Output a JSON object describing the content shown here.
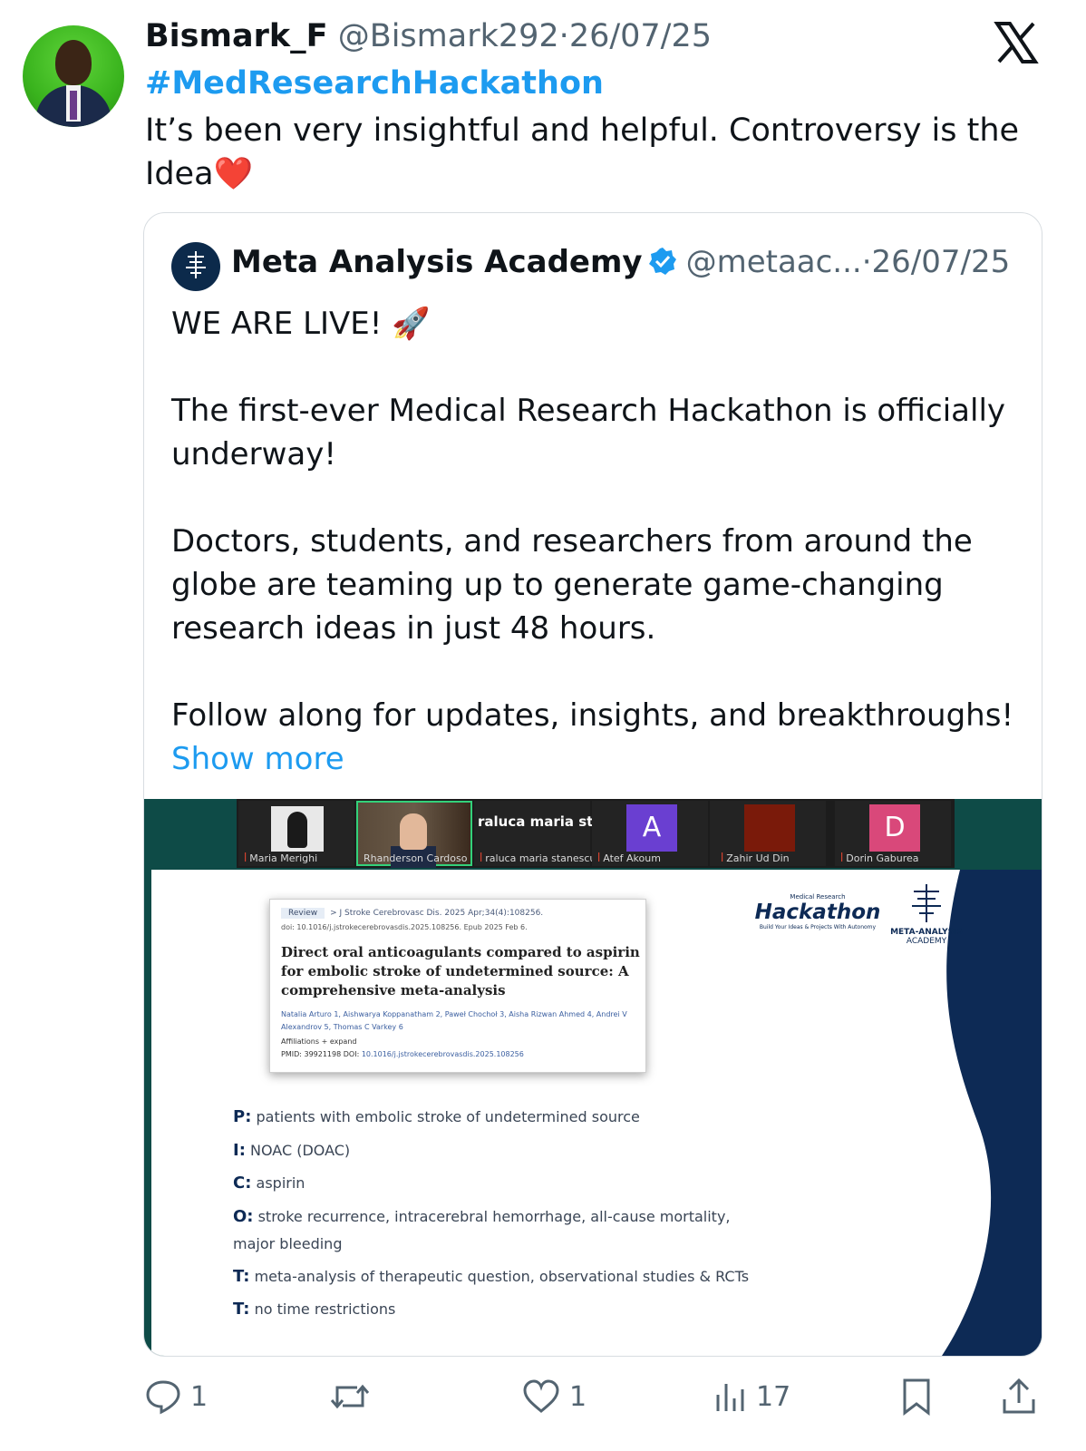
{
  "tweet": {
    "display_name": "Bismark_F",
    "handle": "@Bismark292",
    "sep": "·",
    "date": "26/07/25",
    "hashtag": "#MedResearchHackathon",
    "text": "It’s been very insightful and helpful. Controversy is the Idea",
    "emoji": "❤️"
  },
  "quote": {
    "display_name": "Meta Analysis Academy",
    "handle": "@metaac...",
    "sep": "·",
    "date": "26/07/25",
    "line1": "WE ARE LIVE! 🚀",
    "para1": "The first-ever Medical Research Hackathon is officially underway!",
    "para2": "Doctors, students, and researchers from around the globe are teaming up to generate game-changing research ideas in just 48 hours.",
    "para3": "Follow along for updates, insights, and breakthroughs!",
    "show_more": "Show more"
  },
  "media": {
    "participants": [
      {
        "name": "Maria Merighi"
      },
      {
        "name": "Rhanderson Cardoso"
      },
      {
        "name": "raluca maria stanescu",
        "display": "raluca maria sta..."
      },
      {
        "name": "Atef Akoum",
        "initial": "A",
        "color": "#6a3fd1"
      },
      {
        "name": "Zahir Ud Din",
        "color": "#7a1a0a"
      },
      {
        "name": "Dorin Gaburea",
        "initial": "D",
        "color": "#d9487a"
      }
    ],
    "paper": {
      "tag": "Review",
      "journal": "> J Stroke Cerebrovasc Dis. 2025 Apr;34(4):108256.",
      "doi_line": "doi: 10.1016/j.jstrokecerebrovasdis.2025.108256. Epub 2025 Feb 6.",
      "title": "Direct oral anticoagulants compared to aspirin for embolic stroke of undetermined source: A comprehensive meta-analysis",
      "authors": "Natalia Arturo 1, Aishwarya Koppanatham 2, Paweł Chochoł 3, Aisha Rizwan Ahmed 4, Andrei V Alexandrov 5, Thomas C Varkey 6",
      "affiliations": "Affiliations  + expand",
      "pmid_label": "PMID: 39921198   DOI:",
      "pmid_link": "10.1016/j.jstrokecerebrovasdis.2025.108256"
    },
    "hackathon": {
      "small": "Medical Research",
      "big": "Hackathon",
      "tagline": "Build Your Ideas & Projects With Autonomy"
    },
    "academy": {
      "line1": "META-ANALYSIS",
      "line2": "ACADEMY"
    },
    "pico": [
      {
        "key": "P:",
        "text": "patients with embolic stroke of undetermined source"
      },
      {
        "key": "I:",
        "text": "NOAC (DOAC)"
      },
      {
        "key": "C:",
        "text": "aspirin"
      },
      {
        "key": "O:",
        "text": "stroke recurrence, intracerebral hemorrhage, all-cause mortality,"
      },
      {
        "key": "",
        "text": "major bleeding"
      },
      {
        "key": "T:",
        "text": "meta-analysis of therapeutic question, observational studies & RCTs"
      },
      {
        "key": "T:",
        "text": "no time restrictions"
      }
    ]
  },
  "actions": {
    "replies": "1",
    "reposts": "",
    "likes": "1",
    "views": "17"
  },
  "colors": {
    "accent": "#1d9bf0",
    "muted": "#536471",
    "navy": "#0d2a55",
    "teal": "#0e4b47"
  }
}
